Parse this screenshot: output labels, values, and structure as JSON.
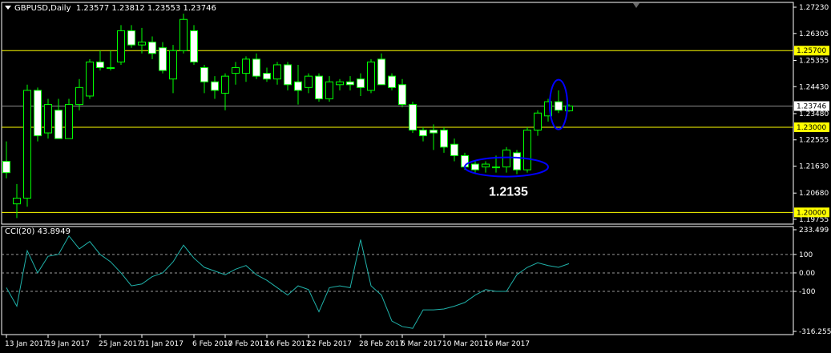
{
  "header": {
    "symbol": "GBPUSD,Daily",
    "ohlc": "1.23577 1.23812 1.23553 1.23746"
  },
  "indicator": {
    "label": "CCI(20) 43.8949"
  },
  "annotations": {
    "low_label": "1.2135"
  },
  "colors": {
    "background": "#000000",
    "frame": "#ffffff",
    "bull": "#000000",
    "bear": "#ffffff",
    "wick": "#00ff00",
    "hline": "#ffff00",
    "ellipse": "#0000ff",
    "cci": "#20b2aa",
    "current_line": "#8c8c8c"
  },
  "chart_data": [
    {
      "type": "candlestick",
      "symbol": "GBPUSD",
      "timeframe": "Daily",
      "ylim": [
        1.19755,
        1.2723
      ],
      "price_ticks": [
        "1.27230",
        "1.26305",
        "1.25355",
        "1.24430",
        "1.23480",
        "1.22555",
        "1.21630",
        "1.20680",
        "1.19755"
      ],
      "horizontal_levels": [
        {
          "value": 1.257,
          "label": "1.25700"
        },
        {
          "value": 1.23,
          "label": "1.23000"
        },
        {
          "value": 1.2,
          "label": "1.20000"
        }
      ],
      "current_price": {
        "value": 1.23746,
        "label": "1.23746"
      },
      "date_ticks": [
        "13 Jan 2017",
        "19 Jan 2017",
        "25 Jan 2017",
        "31 Jan 2017",
        "6 Feb 2017",
        "10 Feb 2017",
        "16 Feb 2017",
        "22 Feb 2017",
        "28 Feb 2017",
        "6 Mar 2017",
        "10 Mar 2017",
        "16 Mar 2017"
      ],
      "candles": [
        {
          "o": 1.218,
          "h": 1.225,
          "l": 1.212,
          "c": 1.214
        },
        {
          "o": 1.203,
          "h": 1.21,
          "l": 1.198,
          "c": 1.205
        },
        {
          "o": 1.205,
          "h": 1.245,
          "l": 1.202,
          "c": 1.243
        },
        {
          "o": 1.243,
          "h": 1.244,
          "l": 1.225,
          "c": 1.227
        },
        {
          "o": 1.228,
          "h": 1.24,
          "l": 1.226,
          "c": 1.238
        },
        {
          "o": 1.236,
          "h": 1.24,
          "l": 1.226,
          "c": 1.226
        },
        {
          "o": 1.226,
          "h": 1.24,
          "l": 1.226,
          "c": 1.238
        },
        {
          "o": 1.238,
          "h": 1.247,
          "l": 1.236,
          "c": 1.244
        },
        {
          "o": 1.241,
          "h": 1.254,
          "l": 1.24,
          "c": 1.253
        },
        {
          "o": 1.253,
          "h": 1.257,
          "l": 1.25,
          "c": 1.251
        },
        {
          "o": 1.251,
          "h": 1.257,
          "l": 1.25,
          "c": 1.251
        },
        {
          "o": 1.253,
          "h": 1.266,
          "l": 1.252,
          "c": 1.264
        },
        {
          "o": 1.264,
          "h": 1.266,
          "l": 1.258,
          "c": 1.259
        },
        {
          "o": 1.259,
          "h": 1.265,
          "l": 1.256,
          "c": 1.26
        },
        {
          "o": 1.26,
          "h": 1.262,
          "l": 1.254,
          "c": 1.256
        },
        {
          "o": 1.258,
          "h": 1.26,
          "l": 1.249,
          "c": 1.25
        },
        {
          "o": 1.247,
          "h": 1.259,
          "l": 1.242,
          "c": 1.257
        },
        {
          "o": 1.257,
          "h": 1.27,
          "l": 1.256,
          "c": 1.268
        },
        {
          "o": 1.264,
          "h": 1.266,
          "l": 1.252,
          "c": 1.253
        },
        {
          "o": 1.251,
          "h": 1.252,
          "l": 1.242,
          "c": 1.246
        },
        {
          "o": 1.246,
          "h": 1.248,
          "l": 1.24,
          "c": 1.243
        },
        {
          "o": 1.242,
          "h": 1.249,
          "l": 1.236,
          "c": 1.248
        },
        {
          "o": 1.249,
          "h": 1.253,
          "l": 1.245,
          "c": 1.251
        },
        {
          "o": 1.249,
          "h": 1.255,
          "l": 1.246,
          "c": 1.254
        },
        {
          "o": 1.254,
          "h": 1.256,
          "l": 1.247,
          "c": 1.248
        },
        {
          "o": 1.249,
          "h": 1.251,
          "l": 1.246,
          "c": 1.247
        },
        {
          "o": 1.247,
          "h": 1.253,
          "l": 1.245,
          "c": 1.252
        },
        {
          "o": 1.252,
          "h": 1.253,
          "l": 1.243,
          "c": 1.245
        },
        {
          "o": 1.246,
          "h": 1.252,
          "l": 1.238,
          "c": 1.243
        },
        {
          "o": 1.244,
          "h": 1.249,
          "l": 1.242,
          "c": 1.248
        },
        {
          "o": 1.248,
          "h": 1.249,
          "l": 1.239,
          "c": 1.24
        },
        {
          "o": 1.24,
          "h": 1.248,
          "l": 1.239,
          "c": 1.246
        },
        {
          "o": 1.245,
          "h": 1.247,
          "l": 1.243,
          "c": 1.246
        },
        {
          "o": 1.246,
          "h": 1.248,
          "l": 1.243,
          "c": 1.245
        },
        {
          "o": 1.247,
          "h": 1.249,
          "l": 1.241,
          "c": 1.244
        },
        {
          "o": 1.243,
          "h": 1.254,
          "l": 1.242,
          "c": 1.253
        },
        {
          "o": 1.254,
          "h": 1.256,
          "l": 1.245,
          "c": 1.245
        },
        {
          "o": 1.248,
          "h": 1.249,
          "l": 1.243,
          "c": 1.244
        },
        {
          "o": 1.245,
          "h": 1.247,
          "l": 1.237,
          "c": 1.238
        },
        {
          "o": 1.238,
          "h": 1.239,
          "l": 1.228,
          "c": 1.229
        },
        {
          "o": 1.229,
          "h": 1.23,
          "l": 1.225,
          "c": 1.227
        },
        {
          "o": 1.229,
          "h": 1.231,
          "l": 1.222,
          "c": 1.228
        },
        {
          "o": 1.229,
          "h": 1.23,
          "l": 1.221,
          "c": 1.223
        },
        {
          "o": 1.224,
          "h": 1.226,
          "l": 1.218,
          "c": 1.22
        },
        {
          "o": 1.22,
          "h": 1.221,
          "l": 1.215,
          "c": 1.216
        },
        {
          "o": 1.217,
          "h": 1.218,
          "l": 1.214,
          "c": 1.215
        },
        {
          "o": 1.216,
          "h": 1.218,
          "l": 1.214,
          "c": 1.217
        },
        {
          "o": 1.216,
          "h": 1.22,
          "l": 1.214,
          "c": 1.216
        },
        {
          "o": 1.216,
          "h": 1.223,
          "l": 1.214,
          "c": 1.222
        },
        {
          "o": 1.221,
          "h": 1.222,
          "l": 1.2135,
          "c": 1.215
        },
        {
          "o": 1.215,
          "h": 1.23,
          "l": 1.214,
          "c": 1.229
        },
        {
          "o": 1.229,
          "h": 1.236,
          "l": 1.227,
          "c": 1.235
        },
        {
          "o": 1.234,
          "h": 1.24,
          "l": 1.232,
          "c": 1.239
        },
        {
          "o": 1.239,
          "h": 1.243,
          "l": 1.235,
          "c": 1.236
        },
        {
          "o": 1.2358,
          "h": 1.2381,
          "l": 1.2355,
          "c": 1.2375
        }
      ],
      "highlights": [
        {
          "center_index": 48,
          "value": 1.216,
          "label": "1.2135"
        },
        {
          "center_index": 53,
          "value": 1.238
        }
      ]
    },
    {
      "type": "line",
      "name": "CCI(20)",
      "last_value": 43.8949,
      "ylim": [
        -316.2554,
        233.499
      ],
      "ticks": [
        "233.499",
        "100",
        "0.00",
        "-100",
        "-316.2554"
      ],
      "levels": [
        100,
        0,
        -100
      ],
      "values": [
        -80,
        -180,
        120,
        0,
        90,
        100,
        200,
        130,
        170,
        100,
        60,
        0,
        -70,
        -60,
        -20,
        0,
        60,
        150,
        80,
        30,
        10,
        -10,
        20,
        40,
        -10,
        -40,
        -80,
        -120,
        -70,
        -90,
        -210,
        -80,
        -70,
        -80,
        180,
        -70,
        -120,
        -260,
        -290,
        -300,
        -200,
        -200,
        -195,
        -180,
        -160,
        -120,
        -90,
        -100,
        -100,
        -10,
        30,
        55,
        40,
        30,
        50
      ],
      "x_ticks": [
        "13 Jan 2017",
        "19 Jan 2017",
        "25 Jan 2017",
        "31 Jan 2017",
        "6 Feb 2017",
        "10 Feb 2017",
        "16 Feb 2017",
        "22 Feb 2017",
        "28 Feb 2017",
        "6 Mar 2017",
        "10 Mar 2017",
        "16 Mar 2017"
      ]
    }
  ]
}
